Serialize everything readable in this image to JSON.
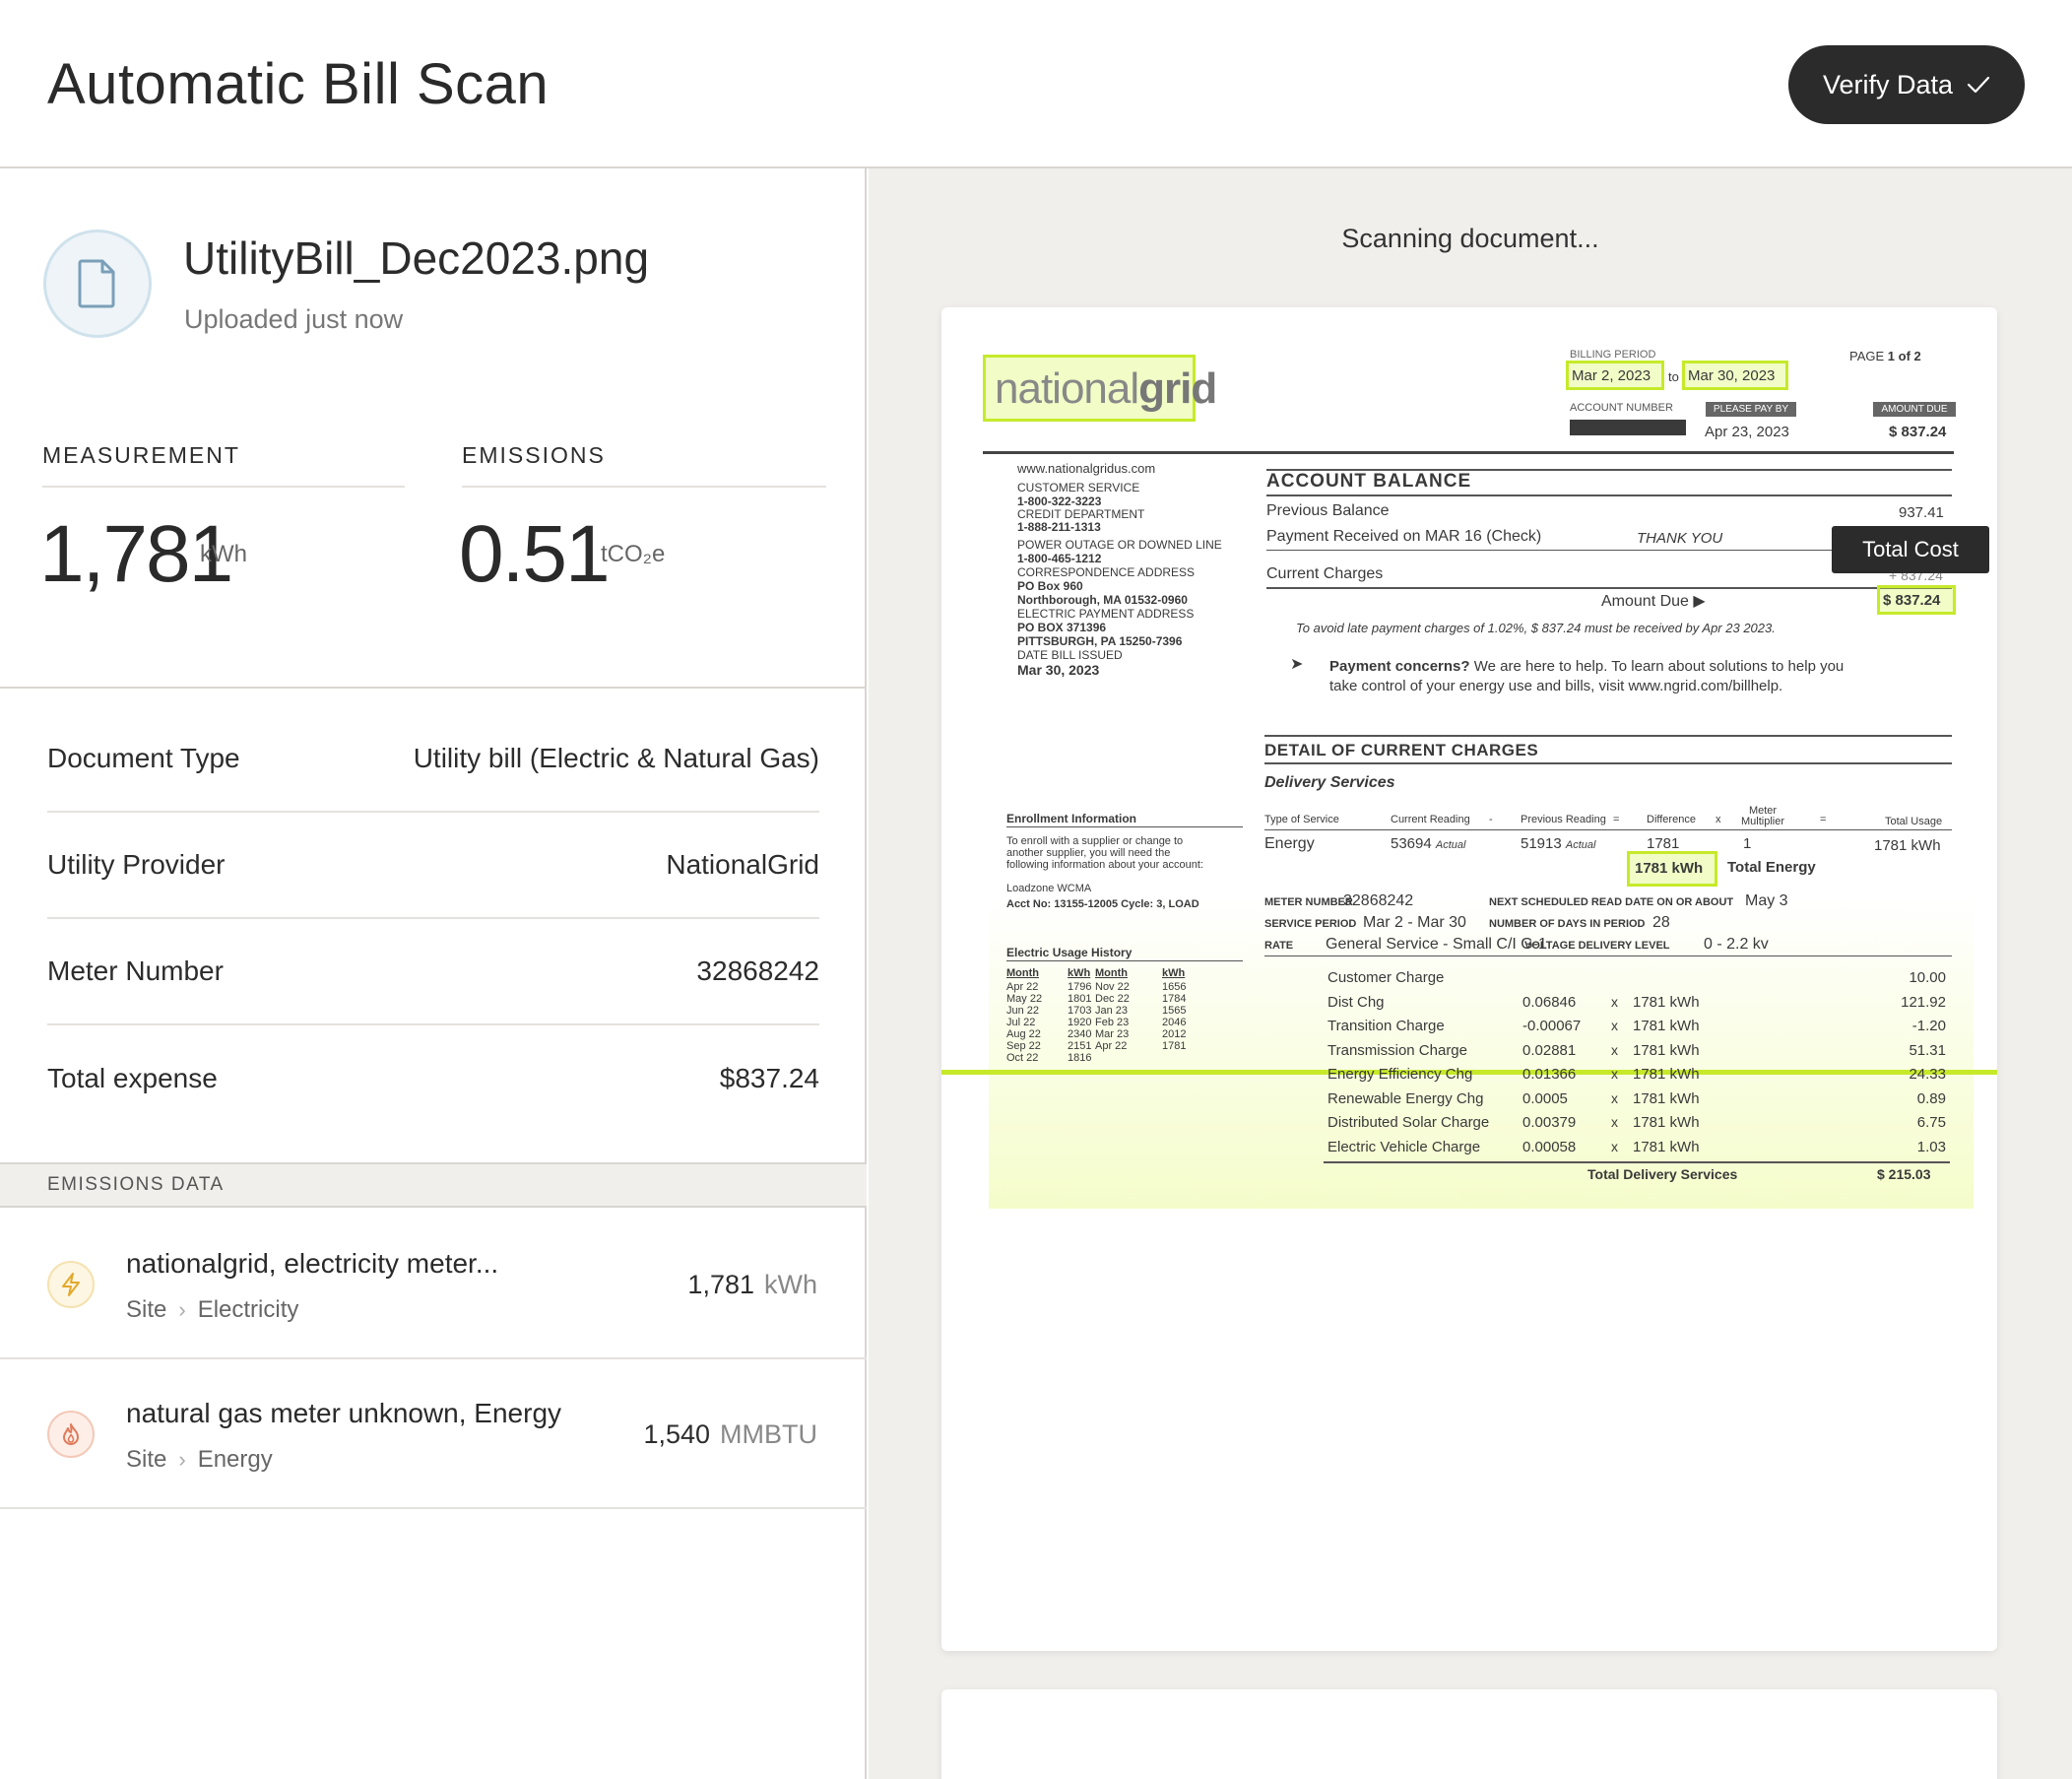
{
  "header": {
    "title": "Automatic Bill Scan",
    "verify_label": "Verify Data"
  },
  "file": {
    "name": "UtilityBill_Dec2023.png",
    "status": "Uploaded just now"
  },
  "metrics": {
    "measurement_label": "MEASUREMENT",
    "measurement_value": "1,781",
    "measurement_unit": "kWh",
    "emissions_label": "EMISSIONS",
    "emissions_value": "0.51",
    "emissions_unit": "tCO₂e"
  },
  "details": [
    {
      "key": "Document Type",
      "value": "Utility bill (Electric & Natural Gas)"
    },
    {
      "key": "Utility Provider",
      "value": "NationalGrid"
    },
    {
      "key": "Meter Number",
      "value": "32868242"
    },
    {
      "key": "Total expense",
      "value": "$837.24"
    }
  ],
  "emissions_data": {
    "header": "EMISSIONS DATA",
    "items": [
      {
        "title": "nationalgrid, electricity meter...",
        "crumb1": "Site",
        "crumb2": "Electricity",
        "value": "1,781",
        "unit": "kWh",
        "icon": "lightning-icon",
        "color": "#e8b84a"
      },
      {
        "title": "natural gas meter unknown, Energy",
        "crumb1": "Site",
        "crumb2": "Energy",
        "value": "1,540",
        "unit": "MMBTU",
        "icon": "flame-icon",
        "color": "#e07a5a"
      }
    ]
  },
  "scan": {
    "status": "Scanning document...",
    "tooltip": "Total Cost"
  },
  "bill": {
    "logo_a": "national",
    "logo_b": "grid",
    "billing_period_label": "BILLING PERIOD",
    "period_start": "Mar 2, 2023",
    "to": "to",
    "period_end": "Mar 30, 2023",
    "page_label": "PAGE",
    "page_value": "1 of 2",
    "account_number_label": "ACCOUNT NUMBER",
    "please_pay_label": "PLEASE PAY BY",
    "amount_due_label": "AMOUNT DUE",
    "pay_by": "Apr 23, 2023",
    "amount_due": "$ 837.24",
    "website": "www.nationalgridus.com",
    "contacts": [
      "CUSTOMER SERVICE",
      "1-800-322-3223",
      "CREDIT DEPARTMENT",
      "1-888-211-1313",
      "POWER OUTAGE OR DOWNED LINE",
      "1-800-465-1212",
      "CORRESPONDENCE ADDRESS",
      "PO Box 960",
      "Northborough, MA 01532-0960",
      "ELECTRIC PAYMENT ADDRESS",
      "PO BOX 371396",
      "PITTSBURGH, PA 15250-7396",
      "DATE BILL ISSUED",
      "Mar 30, 2023"
    ],
    "account_balance": "ACCOUNT BALANCE",
    "previous_balance": "Previous Balance",
    "previous_balance_val": "937.41",
    "payment_received": "Payment Received on MAR 16 (Check)",
    "thank_you": "THANK YOU",
    "current_charges": "Current Charges",
    "current_charges_val": "+ 837.24",
    "amount_due_row": "Amount Due ▶",
    "amount_due_val": "$ 837.24",
    "late_note": "To avoid late payment charges of 1.02%, $ 837.24 must be received by Apr 23 2023.",
    "concerns_bold": "Payment concerns?",
    "concerns_text": "We are here to help. To learn about solutions to help you",
    "concerns_text2": "take control of your energy use and bills, visit www.ngrid.com/billhelp.",
    "detail_title": "DETAIL OF CURRENT CHARGES",
    "delivery_services": "Delivery Services",
    "col_type": "Type of Service",
    "col_current": "Current Reading",
    "col_minus": "-",
    "col_previous": "Previous Reading",
    "col_eq": "=",
    "col_diff": "Difference",
    "col_x": "x",
    "col_mult": "Meter Multiplier",
    "col_eq2": "=",
    "col_total": "Total Usage",
    "row_type": "Energy",
    "row_current": "53694",
    "row_actual": "Actual",
    "row_previous": "51913",
    "row_actual2": "Actual",
    "row_diff": "1781",
    "row_mult": "1",
    "row_total": "1781 kWh",
    "total_energy_label": "Total Energy",
    "total_energy_val": "1781 kWh",
    "meter_number_label": "METER NUMBER",
    "meter_number": "32868242",
    "next_read_label": "NEXT SCHEDULED READ DATE ON OR ABOUT",
    "next_read": "May 3",
    "service_period_label": "SERVICE PERIOD",
    "service_period": "Mar 2 - Mar 30",
    "days_label": "NUMBER OF DAYS IN PERIOD",
    "days": "28",
    "rate_label": "RATE",
    "rate": "General Service - Small C/I G-1",
    "voltage_label": "VOLTAGE DELIVERY LEVEL",
    "voltage": "0 - 2.2 kv",
    "enroll_title": "Enrollment Information",
    "enroll_text": [
      "To enroll with a supplier or change to",
      "another supplier, you will need the",
      "following information about your account:"
    ],
    "loadzone": "Loadzone   WCMA",
    "acct_no": "Acct No:   13155-12005   Cycle: 3, LOAD",
    "usage_title": "Electric Usage History",
    "usage_headers": [
      "Month",
      "kWh",
      "Month",
      "kWh"
    ],
    "usage_rows": [
      [
        "Apr 22",
        "1796",
        "Nov 22",
        "1656"
      ],
      [
        "May 22",
        "1801",
        "Dec 22",
        "1784"
      ],
      [
        "Jun 22",
        "1703",
        "Jan 23",
        "1565"
      ],
      [
        "Jul 22",
        "1920",
        "Feb 23",
        "2046"
      ],
      [
        "Aug 22",
        "2340",
        "Mar 23",
        "2012"
      ],
      [
        "Sep 22",
        "2151",
        "Apr 22",
        "1781"
      ],
      [
        "Oct 22",
        "1816",
        "",
        ""
      ]
    ],
    "charges": [
      {
        "name": "Customer Charge",
        "rate": "",
        "x": "",
        "qty": "",
        "amt": "10.00"
      },
      {
        "name": "Dist Chg",
        "rate": "0.06846",
        "x": "x",
        "qty": "1781 kWh",
        "amt": "121.92"
      },
      {
        "name": "Transition Charge",
        "rate": "-0.00067",
        "x": "x",
        "qty": "1781 kWh",
        "amt": "-1.20"
      },
      {
        "name": "Transmission Charge",
        "rate": "0.02881",
        "x": "x",
        "qty": "1781 kWh",
        "amt": "51.31"
      },
      {
        "name": "Energy Efficiency Chg",
        "rate": "0.01366",
        "x": "x",
        "qty": "1781 kWh",
        "amt": "24.33"
      },
      {
        "name": "Renewable Energy Chg",
        "rate": "0.0005",
        "x": "x",
        "qty": "1781 kWh",
        "amt": "0.89"
      },
      {
        "name": "Distributed Solar Charge",
        "rate": "0.00379",
        "x": "x",
        "qty": "1781 kWh",
        "amt": "6.75"
      },
      {
        "name": "Electric Vehicle Charge",
        "rate": "0.00058",
        "x": "x",
        "qty": "1781 kWh",
        "amt": "1.03"
      }
    ],
    "total_delivery_label": "Total Delivery Services",
    "total_delivery_val": "$ 215.03"
  }
}
